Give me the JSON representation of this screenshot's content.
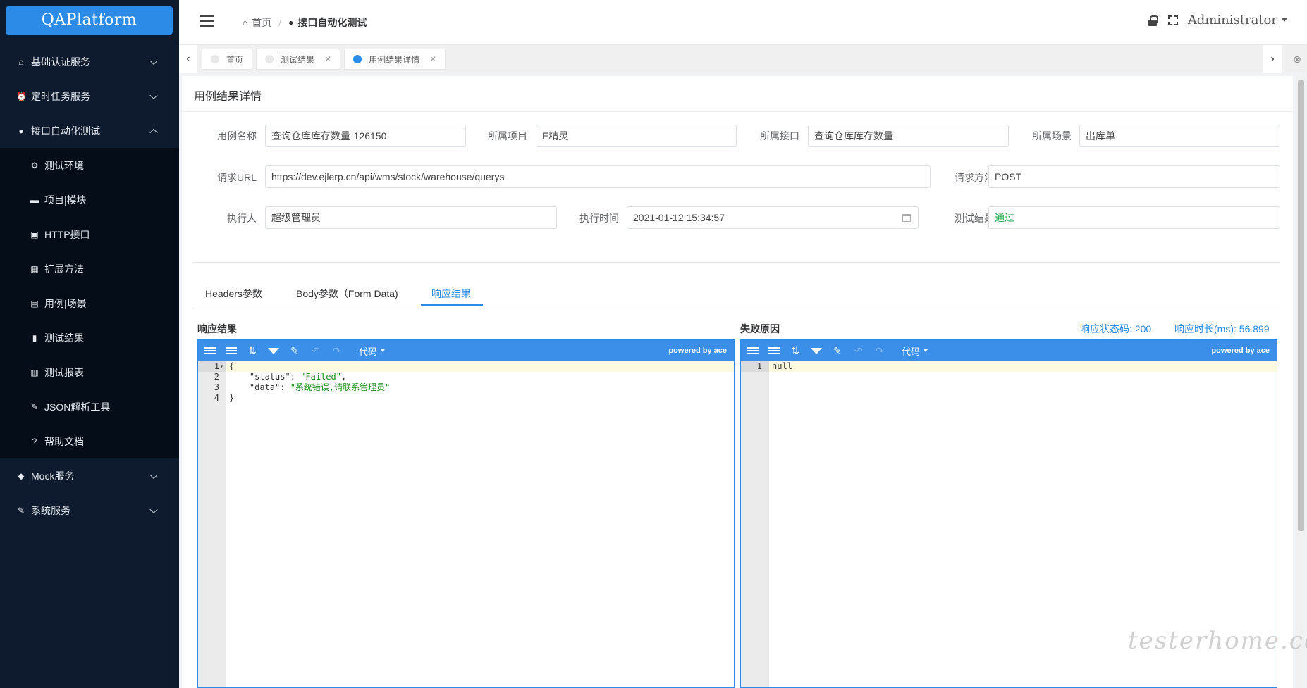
{
  "app": {
    "logo": "QAPlatform"
  },
  "sidebar": {
    "items": [
      {
        "label": "基础认证服务",
        "icon": "home-icon",
        "glyph": "⌂",
        "chevron": "down"
      },
      {
        "label": "定时任务服务",
        "icon": "alarm-clock-icon",
        "glyph": "⏰",
        "chevron": "down"
      },
      {
        "label": "接口自动化测试",
        "icon": "drop-icon",
        "glyph": "●",
        "chevron": "up"
      }
    ],
    "subitems": [
      {
        "label": "测试环境",
        "icon": "gear-icon",
        "glyph": "⚙"
      },
      {
        "label": "项目|模块",
        "icon": "folder-icon",
        "glyph": "▬"
      },
      {
        "label": "HTTP接口",
        "icon": "robot-icon",
        "glyph": "▣"
      },
      {
        "label": "扩展方法",
        "icon": "grid-icon",
        "glyph": "▦"
      },
      {
        "label": "用例|场景",
        "icon": "table-icon",
        "glyph": "▤"
      },
      {
        "label": "测试结果",
        "icon": "file-icon",
        "glyph": "▮"
      },
      {
        "label": "测试报表",
        "icon": "bar-chart-icon",
        "glyph": "▥"
      },
      {
        "label": "JSON解析工具",
        "icon": "wrench-icon",
        "glyph": "✎"
      },
      {
        "label": "帮助文档",
        "icon": "question-icon",
        "glyph": "?"
      }
    ],
    "bottom_items": [
      {
        "label": "Mock服务",
        "icon": "cube-icon",
        "glyph": "◆",
        "chevron": "down"
      },
      {
        "label": "系统服务",
        "icon": "hammer-icon",
        "glyph": "✎",
        "chevron": "down"
      }
    ]
  },
  "header": {
    "breadcrumb_home": "首页",
    "breadcrumb_sep": "/",
    "breadcrumb_current": "接口自动化测试",
    "user": "Administrator"
  },
  "tabs": [
    {
      "label": "首页",
      "closable": false,
      "active": false
    },
    {
      "label": "测试结果",
      "closable": true,
      "active": false
    },
    {
      "label": "用例结果详情",
      "closable": true,
      "active": true
    }
  ],
  "panel": {
    "title": "用例结果详情",
    "fields": {
      "case_name_label": "用例名称",
      "case_name": "查询仓库库存数量-126150",
      "project_label": "所属项目",
      "project": "E精灵",
      "interface_label": "所属接口",
      "interface": "查询仓库库存数量",
      "scene_label": "所属场景",
      "scene": "出库单",
      "url_label": "请求URL",
      "url": "https://dev.ejlerp.cn/api/wms/stock/warehouse/querys",
      "method_label": "请求方法",
      "method": "POST",
      "executor_label": "执行人",
      "executor": "超级管理员",
      "exec_time_label": "执行时间",
      "exec_time": "2021-01-12 15:34:57",
      "result_label": "测试结果",
      "result": "通过"
    },
    "result_tabs": [
      "Headers参数",
      "Body参数（Form Data)",
      "响应结果"
    ],
    "active_result_tab": 2,
    "response_label": "响应结果",
    "failure_label": "失败原因",
    "status_code_label": "响应状态码:",
    "status_code": "200",
    "duration_label": "响应时长(ms):",
    "duration": "56.899"
  },
  "editors": {
    "toolbar_mode": "代码",
    "powered_by": "powered by ace",
    "response_lines": [
      {
        "n": "1",
        "parts": [
          [
            "{",
            ""
          ]
        ]
      },
      {
        "n": "2",
        "parts": [
          [
            "    \"status\": ",
            ""
          ],
          [
            "\"Failed\"",
            "str"
          ],
          [
            ",",
            ""
          ]
        ]
      },
      {
        "n": "3",
        "parts": [
          [
            "    \"data\": ",
            ""
          ],
          [
            "\"系统错误,请联系管理员\"",
            "str"
          ]
        ]
      },
      {
        "n": "4",
        "parts": [
          [
            "}",
            ""
          ]
        ]
      }
    ],
    "failure_lines": [
      {
        "n": "1",
        "parts": [
          [
            "null",
            ""
          ]
        ]
      }
    ]
  },
  "watermark": "testerhome.com"
}
